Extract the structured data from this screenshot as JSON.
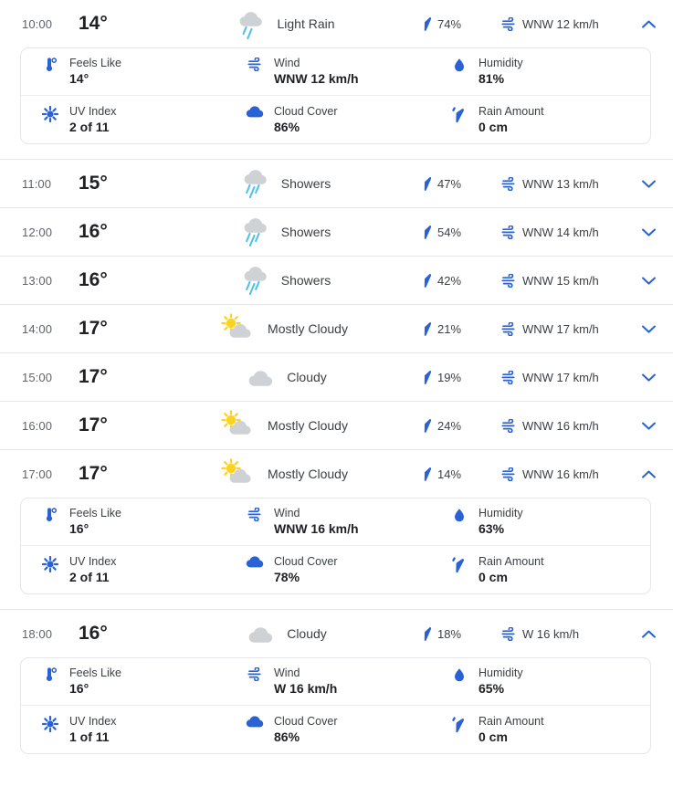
{
  "detail_labels": {
    "feels_like": "Feels Like",
    "wind": "Wind",
    "humidity": "Humidity",
    "uv_index": "UV Index",
    "cloud_cover": "Cloud Cover",
    "rain_amount": "Rain Amount"
  },
  "colors": {
    "accent_blue": "#2962d4",
    "rain_blue": "#4fc3e8",
    "cloud_gray": "#cfd2d4",
    "sun_yellow": "#ffd21f",
    "text_primary": "#202124",
    "text_secondary": "#5f6368",
    "row_border": "#e6e6e6",
    "card_border": "#e4e6e9"
  },
  "hours": [
    {
      "time": "10:00",
      "temp": "14°",
      "condition": "Light Rain",
      "icon": "light-rain-icon",
      "precip": "74%",
      "wind": "WNW 12 km/h",
      "expanded": true,
      "chevron": "chevron-up-icon",
      "details": {
        "feels_like": "14°",
        "wind": "WNW 12 km/h",
        "humidity": "81%",
        "uv_index": "2 of 11",
        "cloud_cover": "86%",
        "rain_amount": "0 cm"
      }
    },
    {
      "time": "11:00",
      "temp": "15°",
      "condition": "Showers",
      "icon": "showers-icon",
      "precip": "47%",
      "wind": "WNW 13 km/h",
      "expanded": false,
      "chevron": "chevron-down-icon"
    },
    {
      "time": "12:00",
      "temp": "16°",
      "condition": "Showers",
      "icon": "showers-icon",
      "precip": "54%",
      "wind": "WNW 14 km/h",
      "expanded": false,
      "chevron": "chevron-down-icon"
    },
    {
      "time": "13:00",
      "temp": "16°",
      "condition": "Showers",
      "icon": "showers-icon",
      "precip": "42%",
      "wind": "WNW 15 km/h",
      "expanded": false,
      "chevron": "chevron-down-icon"
    },
    {
      "time": "14:00",
      "temp": "17°",
      "condition": "Mostly Cloudy",
      "icon": "mostly-cloudy-icon",
      "precip": "21%",
      "wind": "WNW 17 km/h",
      "expanded": false,
      "chevron": "chevron-down-icon"
    },
    {
      "time": "15:00",
      "temp": "17°",
      "condition": "Cloudy",
      "icon": "cloudy-icon",
      "precip": "19%",
      "wind": "WNW 17 km/h",
      "expanded": false,
      "chevron": "chevron-down-icon"
    },
    {
      "time": "16:00",
      "temp": "17°",
      "condition": "Mostly Cloudy",
      "icon": "mostly-cloudy-icon",
      "precip": "24%",
      "wind": "WNW 16 km/h",
      "expanded": false,
      "chevron": "chevron-down-icon"
    },
    {
      "time": "17:00",
      "temp": "17°",
      "condition": "Mostly Cloudy",
      "icon": "mostly-cloudy-icon",
      "precip": "14%",
      "wind": "WNW 16 km/h",
      "expanded": true,
      "chevron": "chevron-up-icon",
      "details": {
        "feels_like": "16°",
        "wind": "WNW 16 km/h",
        "humidity": "63%",
        "uv_index": "2 of 11",
        "cloud_cover": "78%",
        "rain_amount": "0 cm"
      }
    },
    {
      "time": "18:00",
      "temp": "16°",
      "condition": "Cloudy",
      "icon": "cloudy-icon",
      "precip": "18%",
      "wind": "W 16 km/h",
      "expanded": true,
      "chevron": "chevron-up-icon",
      "details": {
        "feels_like": "16°",
        "wind": "W 16 km/h",
        "humidity": "65%",
        "uv_index": "1 of 11",
        "cloud_cover": "86%",
        "rain_amount": "0 cm"
      }
    }
  ]
}
